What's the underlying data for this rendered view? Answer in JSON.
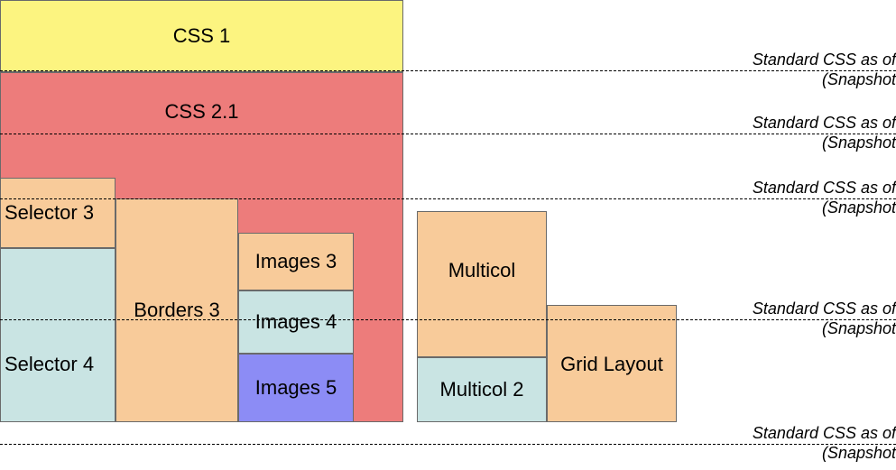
{
  "blocks": {
    "css1": "CSS 1",
    "css21": "CSS 2.1",
    "selector3": "Selector 3",
    "selector4": "Selector 4",
    "borders3": "Borders 3",
    "images3": "Images 3",
    "images4": "Images 4",
    "images5": "Images 5",
    "multicol": "Multicol",
    "multicol2": "Multicol 2",
    "gridlayout": "Grid Layout"
  },
  "annotations": {
    "a1_line1": "Standard CSS as of",
    "a1_line2": "(Snapshot ",
    "a2_line1": "Standard CSS as of",
    "a2_line2": "(Snapshot ",
    "a3_line1": "Standard CSS as of",
    "a3_line2": "(Snapshot ",
    "a4_line1": "Standard CSS as of",
    "a4_line2": "(Snapshot ",
    "a5_line1": "Standard CSS as of",
    "a5_line2": "(Snapshot "
  },
  "colors": {
    "yellow": "#fcf480",
    "red": "#ed7c7b",
    "orange": "#f8cb9a",
    "blue": "#c9e4e3",
    "purple": "#8c8cf5"
  }
}
